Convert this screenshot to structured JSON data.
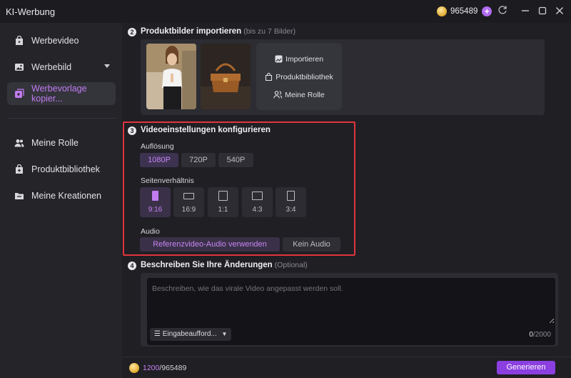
{
  "window": {
    "title": "KI-Werbung",
    "credits": "965489"
  },
  "sidebar": {
    "items": [
      {
        "label": "Werbevideo",
        "icon": "video-bag-icon"
      },
      {
        "label": "Werbebild",
        "icon": "image-icon"
      },
      {
        "label": "Werbevorlage kopier...",
        "icon": "copy-template-icon"
      },
      {
        "label": "Meine Rolle",
        "icon": "users-icon"
      },
      {
        "label": "Produktbibliothek",
        "icon": "library-icon"
      },
      {
        "label": "Meine Kreationen",
        "icon": "folder-icon"
      }
    ],
    "active_index": 2
  },
  "step2": {
    "number": "2",
    "title": "Produktbilder importieren",
    "hint": "(bis zu 7 Bilder)",
    "actions": [
      "Importieren",
      "Produktbibliothek",
      "Meine Rolle"
    ]
  },
  "step3": {
    "number": "3",
    "title": "Videoeinstellungen konfigurieren",
    "resolution_label": "Auflösung",
    "resolutions": [
      "1080P",
      "720P",
      "540P"
    ],
    "resolution_selected": "1080P",
    "ratio_label": "Seitenverhältnis",
    "ratios": [
      "9:16",
      "16:9",
      "1:1",
      "4:3",
      "3:4"
    ],
    "ratio_selected": "9:16",
    "audio_label": "Audio",
    "audio_options": [
      "Referenzvideo-Audio verwenden",
      "Kein Audio"
    ],
    "audio_selected": "Referenzvideo-Audio verwenden"
  },
  "step4": {
    "number": "4",
    "title": "Beschreiben Sie Ihre Änderungen",
    "hint": "(Optional)",
    "placeholder": "Beschreiben, wie das virale Video angepasst werden soll.",
    "prompt_select": "Eingabeaufford...",
    "count": "0",
    "max": "/2000"
  },
  "bottom": {
    "used": "1200",
    "total": "/965489",
    "generate_label": "Generieren"
  },
  "colors": {
    "accent": "#c784f3",
    "button": "#8b3fe0",
    "highlight": "#e0353e"
  }
}
